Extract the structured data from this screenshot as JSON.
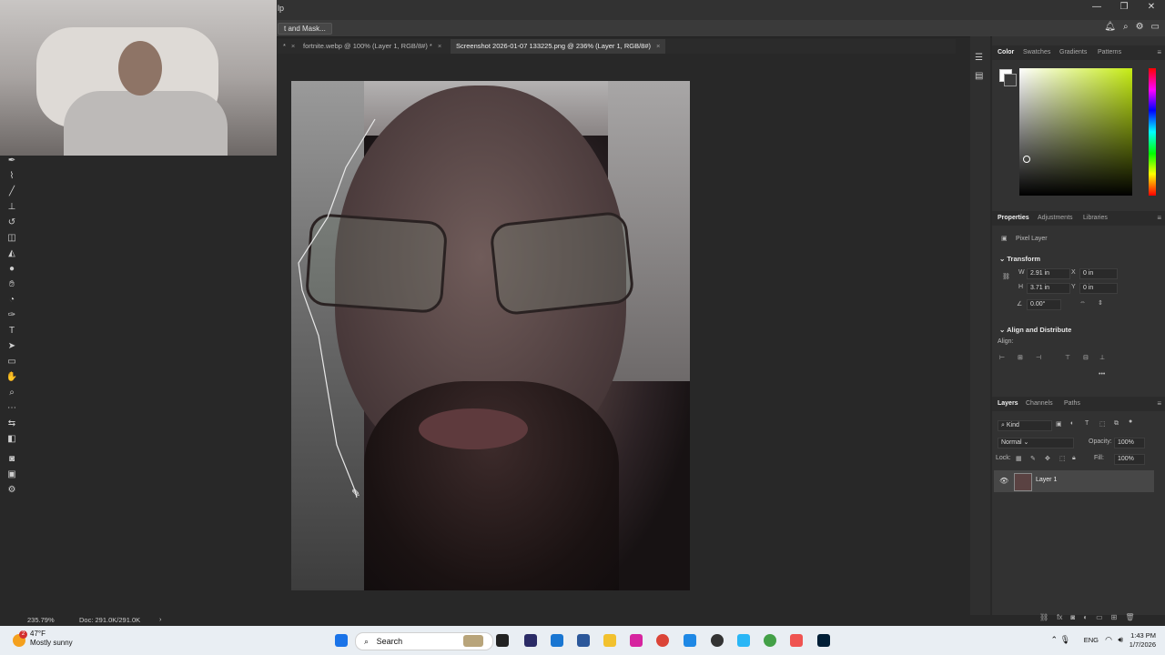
{
  "menu": {
    "partial_label": "lp"
  },
  "options_bar": {
    "select_mask_label": "t and Mask..."
  },
  "window_controls": {
    "minimize": "—",
    "restore": "❐",
    "close": "✕"
  },
  "tabs": [
    {
      "label": "*",
      "close": "×"
    },
    {
      "label": "fortnite.webp @ 100% (Layer 1, RGB/8#) *",
      "close": "×"
    },
    {
      "label": "Screenshot 2026-01-07 133225.png @ 236% (Layer 1, RGB/8#)",
      "close": "×"
    }
  ],
  "status": {
    "zoom": "235.79%",
    "doc": "Doc: 291.0K/291.0K",
    "arrow": "›"
  },
  "color_panel": {
    "tabs": [
      "Color",
      "Swatches",
      "Gradients",
      "Patterns"
    ],
    "hue_color": "#c6ec14"
  },
  "properties_panel": {
    "tabs": [
      "Properties",
      "Adjustments",
      "Libraries"
    ],
    "layer_type": "Pixel Layer",
    "transform_title": "Transform",
    "w_label": "W",
    "w_value": "2.91 in",
    "x_label": "X",
    "x_value": "0 in",
    "h_label": "H",
    "h_value": "3.71 in",
    "y_label": "Y",
    "y_value": "0 in",
    "angle_value": "0.00°",
    "align_title": "Align and Distribute",
    "align_label": "Align:",
    "more": "•••"
  },
  "layers_panel": {
    "tabs": [
      "Layers",
      "Channels",
      "Paths"
    ],
    "kind_label": "Kind",
    "blend_mode": "Normal",
    "opacity_label": "Opacity:",
    "opacity_value": "100%",
    "lock_label": "Lock:",
    "fill_label": "Fill:",
    "fill_value": "100%",
    "layer_name": "Layer 1"
  },
  "taskbar": {
    "weather_temp": "47°F",
    "weather_desc": "Mostly sunny",
    "notification_count": "2",
    "search_label": "Search",
    "language": "ENG",
    "time": "1:43 PM",
    "date": "1/7/2026"
  }
}
